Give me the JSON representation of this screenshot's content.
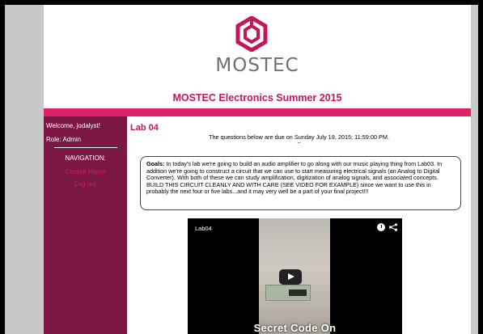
{
  "header": {
    "brand": "MOSTEC",
    "site_title": "MOSTEC Electronics Summer 2015",
    "logo_icon": "mostec-hexagon-logo",
    "logo_color": "#c2185b"
  },
  "sidebar": {
    "welcome": "Welcome, jodalyst!",
    "role": "Role: Admin",
    "nav_title": "NAVIGATION:",
    "links": [
      {
        "label": "Course Home"
      },
      {
        "label": "Log out"
      }
    ]
  },
  "main": {
    "lab_title": "Lab 04",
    "due": "The questions below are due on Sunday July 19, 2015; 11:59:00 PM.",
    "separator": "--",
    "goals_label": "Goals:",
    "goals_text": "In today's lab we're going to build an audio amplifier to go along with our music playing thing from Lab03. In addition we're going to construct a circuit that we can use to start measuring electrical signals (an Analog to Digital Converter). With both of these we can study amplification, digitization of analog signals, and associated concepts. BUILD THIS CIRCUIT CLEANLY AND WITH CARE (SEE VIDEO FOR EXAMPLE) since we want to use this in probably the next four or five labs...and it may very well be a part of your final project!!!"
  },
  "video": {
    "title": "Lab04",
    "caption": "Secret Code On",
    "icons": [
      "clock-icon",
      "share-icon",
      "play-icon"
    ]
  },
  "colors": {
    "accent": "#c2185b",
    "pink_bar": "#e0206b",
    "sidebar_bg": "#7b1742",
    "nav_link": "#d91e63"
  }
}
